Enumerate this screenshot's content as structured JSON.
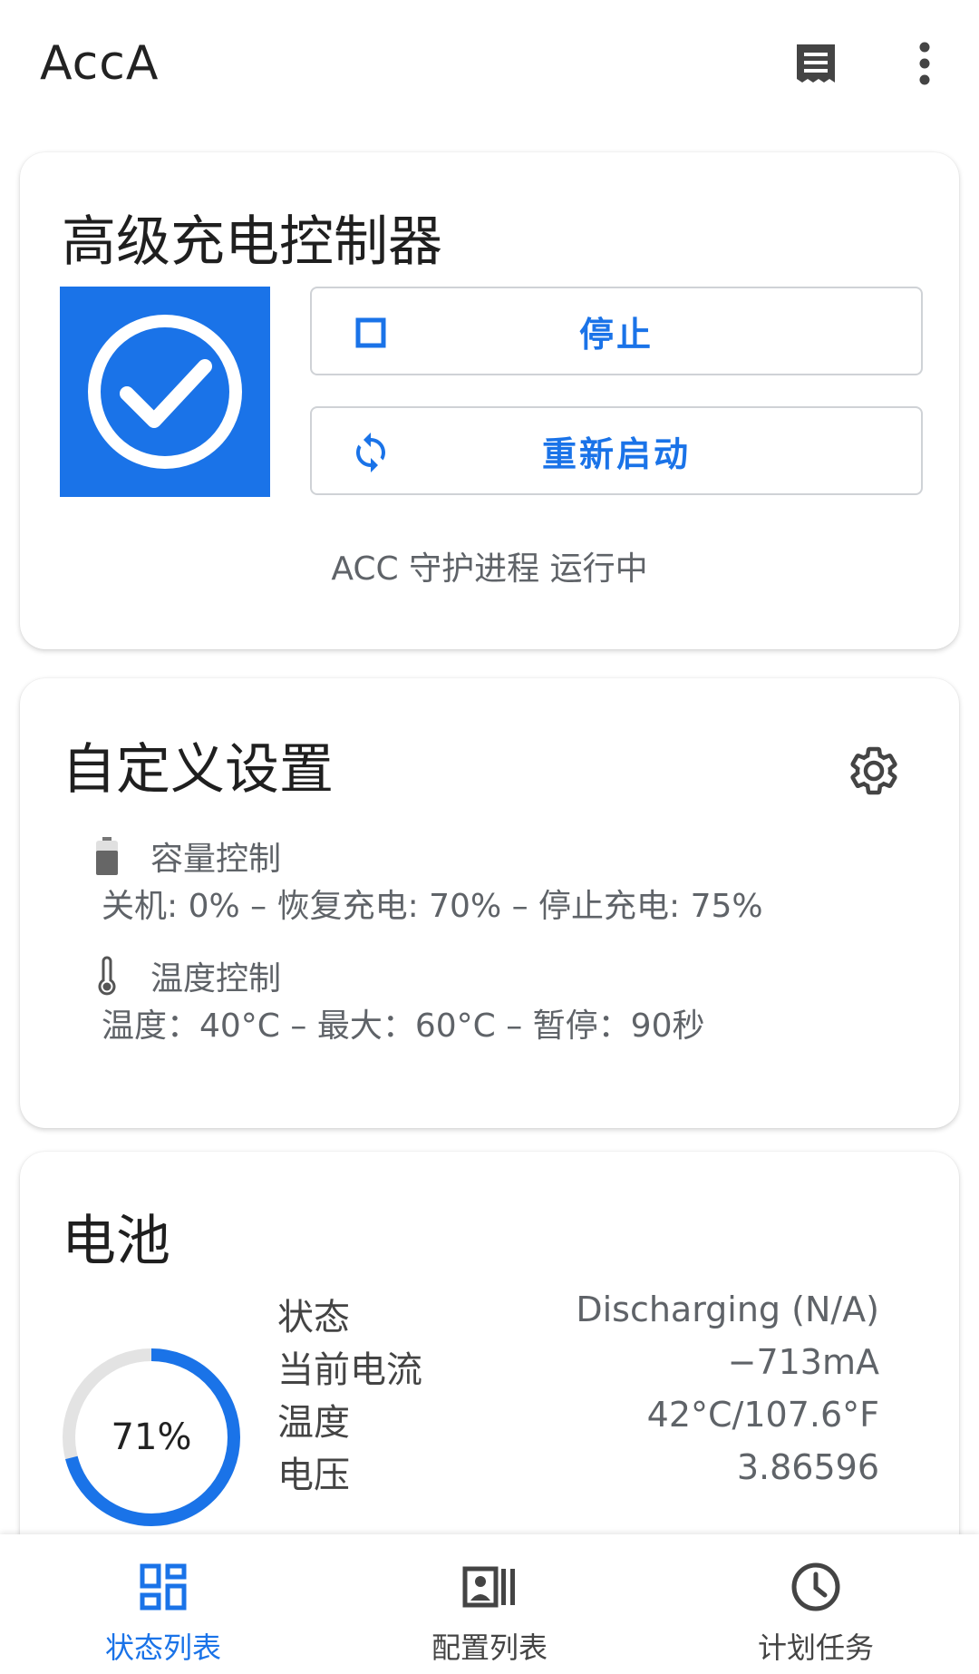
{
  "colors": {
    "accent": "#1a73e8",
    "secondary_text": "#5f6368",
    "track": "#e3e3e3"
  },
  "appbar": {
    "title": "AccA",
    "log_icon": "log-icon",
    "more_icon": "more-vert-icon"
  },
  "acc_card": {
    "title": "高级充电控制器",
    "status_icon": "check-circle-icon",
    "stop_label": "停止",
    "stop_icon": "stop-square-icon",
    "restart_label": "重新启动",
    "restart_icon": "sync-icon",
    "daemon_status": "ACC 守护进程 运行中"
  },
  "custom_card": {
    "title": "自定义设置",
    "settings_icon": "gear-icon",
    "capacity": {
      "icon": "battery-icon",
      "title": "容量控制",
      "detail": "关机: 0% – 恢复充电: 70% – 停止充电: 75%"
    },
    "temperature": {
      "icon": "thermometer-icon",
      "title": "温度控制",
      "detail": "温度：40°C – 最大：60°C – 暂停：90秒"
    }
  },
  "battery_card": {
    "title": "电池",
    "level_percent": 71,
    "level_label": "71%",
    "stats": [
      {
        "label": "状态",
        "value": "Discharging (N/A)"
      },
      {
        "label": "当前电流",
        "value": "−713mA"
      },
      {
        "label": "温度",
        "value": "42°C/107.6°F"
      },
      {
        "label": "电压",
        "value": "3.86596"
      }
    ]
  },
  "bottom_nav": {
    "items": [
      {
        "label": "状态列表",
        "icon": "dashboard-icon",
        "active": true
      },
      {
        "label": "配置列表",
        "icon": "profiles-icon",
        "active": false
      },
      {
        "label": "计划任务",
        "icon": "clock-icon",
        "active": false
      }
    ]
  }
}
